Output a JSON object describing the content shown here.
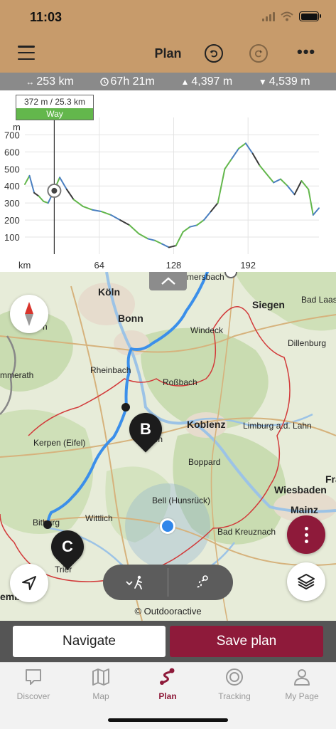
{
  "status_bar": {
    "time": "11:03"
  },
  "toolbar": {
    "title": "Plan"
  },
  "stats": {
    "distance": "253 km",
    "duration": "67h 21m",
    "ascent": "4,397 m",
    "descent": "4,539 m"
  },
  "elevation_chart": {
    "y_unit": "m",
    "x_unit": "km",
    "cursor_readout": "372 m / 25.3 km",
    "cursor_label": "Way"
  },
  "chart_data": {
    "type": "line",
    "xlabel": "km",
    "ylabel": "m",
    "xlim": [
      0,
      253
    ],
    "ylim": [
      0,
      760
    ],
    "x_ticks": [
      64,
      128,
      192
    ],
    "y_ticks": [
      100,
      200,
      300,
      400,
      500,
      600,
      700
    ],
    "x": [
      0,
      4,
      8,
      12,
      16,
      20,
      25,
      30,
      36,
      42,
      50,
      58,
      66,
      74,
      82,
      90,
      98,
      106,
      112,
      118,
      124,
      130,
      136,
      142,
      148,
      154,
      160,
      166,
      172,
      178,
      184,
      190,
      196,
      202,
      208,
      214,
      220,
      226,
      232,
      238,
      244,
      248,
      253
    ],
    "values": [
      410,
      460,
      360,
      340,
      310,
      300,
      372,
      450,
      380,
      320,
      280,
      260,
      250,
      230,
      200,
      170,
      120,
      90,
      80,
      60,
      40,
      50,
      130,
      160,
      170,
      200,
      250,
      300,
      500,
      560,
      620,
      650,
      590,
      520,
      470,
      420,
      440,
      400,
      350,
      430,
      380,
      230,
      270
    ],
    "cursor_x": 25.3,
    "cursor_y": 372,
    "grid": true
  },
  "map": {
    "cities": [
      {
        "name": "Köln",
        "big": true
      },
      {
        "name": "Bonn",
        "big": true
      },
      {
        "name": "Siegen",
        "big": true
      },
      {
        "name": "Bad Laasphe",
        "big": false
      },
      {
        "name": "Windeck",
        "big": false
      },
      {
        "name": "Dillenburg",
        "big": false
      },
      {
        "name": "Rheinbach",
        "big": false
      },
      {
        "name": "Roßbach",
        "big": false
      },
      {
        "name": "Koblenz",
        "big": true
      },
      {
        "name": "Limburg a.d. Lahn",
        "big": false
      },
      {
        "name": "Kerpen (Eifel)",
        "big": false
      },
      {
        "name": "Mayen",
        "big": false
      },
      {
        "name": "Boppard",
        "big": false
      },
      {
        "name": "Wiesbaden",
        "big": true
      },
      {
        "name": "Bell (Hunsrück)",
        "big": false
      },
      {
        "name": "Mainz",
        "big": true
      },
      {
        "name": "Bitburg",
        "big": false
      },
      {
        "name": "Wittlich",
        "big": false
      },
      {
        "name": "Bad Kreuznach",
        "big": false
      },
      {
        "name": "Trier",
        "big": false
      },
      {
        "name": "mmersbach",
        "big": false
      },
      {
        "name": "mmerath",
        "big": false
      },
      {
        "name": "Fra",
        "big": true
      },
      {
        "name": "emb",
        "big": true
      },
      {
        "name": "n",
        "big": false
      }
    ],
    "markers": {
      "b": "B",
      "c": "C"
    },
    "copyright": "© Outdooractive"
  },
  "actions": {
    "navigate": "Navigate",
    "save": "Save plan"
  },
  "tabs": [
    {
      "label": "Discover",
      "icon": "discover-icon"
    },
    {
      "label": "Map",
      "icon": "map-icon"
    },
    {
      "label": "Plan",
      "icon": "plan-icon",
      "active": true
    },
    {
      "label": "Tracking",
      "icon": "tracking-icon"
    },
    {
      "label": "My Page",
      "icon": "my-page-icon"
    }
  ],
  "colors": {
    "header": "#c79b6b",
    "accent": "#8e1a3a",
    "route": "#3b8fea",
    "way_green": "#63b74c"
  }
}
